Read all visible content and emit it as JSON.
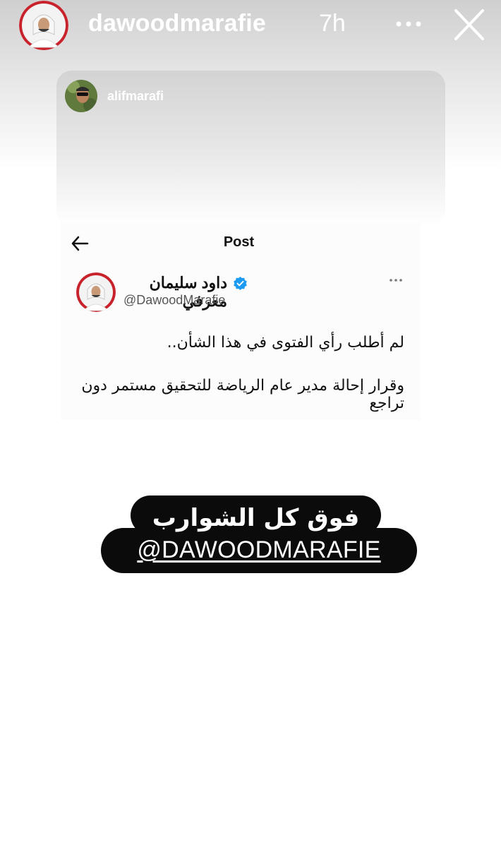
{
  "story": {
    "username": "dawoodmarafie",
    "time": "7h"
  },
  "shared_post": {
    "username": "alifmarafi"
  },
  "post_view": {
    "title": "Post",
    "tweet": {
      "display_name": "داود سليمان معرفي",
      "handle": "@DawoodMarafie",
      "verified": true,
      "lines": [
        "لم أطلب رأي الفتوى في هذا الشأن..",
        "وقرار إحالة مدير عام الرياضة للتحقيق مستمر دون تراجع"
      ]
    }
  },
  "caption": {
    "line1": "فوق كل الشوارب",
    "line2": "@DAWOODMARAFIE"
  },
  "colors": {
    "verified": "#1d9bf0",
    "sticker_bg": "#0b0b0b"
  },
  "icons": {
    "more": "more-horizontal-icon",
    "close": "close-icon",
    "back": "arrow-left-icon",
    "verified": "verified-badge-icon"
  }
}
